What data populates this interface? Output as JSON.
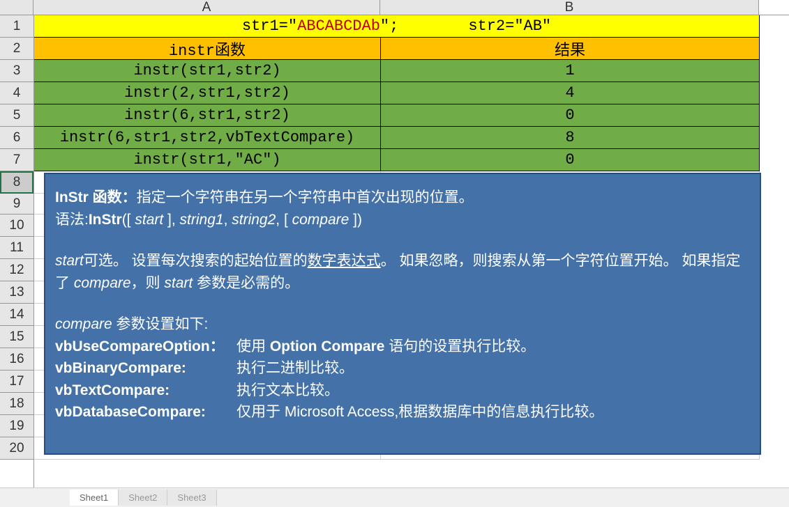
{
  "columns": {
    "a": "A",
    "b": "B"
  },
  "rows": [
    "1",
    "2",
    "3",
    "4",
    "5",
    "6",
    "7",
    "8",
    "9",
    "10",
    "11",
    "12",
    "13",
    "14",
    "15",
    "16",
    "17",
    "18",
    "19",
    "20"
  ],
  "header": {
    "str1_prefix": "str1=\"",
    "str1_red": "ABCABCDAb",
    "str1_suffix": "\";",
    "str2": "str2=\"AB\""
  },
  "row2": {
    "a": "instr函数",
    "b": "结果"
  },
  "data_rows": [
    {
      "a": "instr(str1,str2)",
      "b": "1"
    },
    {
      "a": "instr(2,str1,str2)",
      "b": "4"
    },
    {
      "a": "instr(6,str1,str2)",
      "b": "0"
    },
    {
      "a": "instr(6,str1,str2,vbTextCompare)",
      "b": "8"
    },
    {
      "a": "instr(str1,\"AC\")",
      "b": "0"
    }
  ],
  "doc": {
    "title_bold": "InStr 函数：",
    "title_rest": "指定一个字符串在另一个字符串中首次出现的位置。",
    "syntax_label": "语法:",
    "syntax_bold": "InStr",
    "syntax_rest1": "([ ",
    "syntax_i1": "start",
    "syntax_rest2": " ], ",
    "syntax_i2": "string1",
    "syntax_rest3": ", ",
    "syntax_i3": "string2",
    "syntax_rest4": ", [ ",
    "syntax_i4": "compare",
    "syntax_rest5": " ])",
    "start_i": "start",
    "start_text1": "可选。 设置每次搜索的起始位置的",
    "start_underline": "数字表达式",
    "start_text2": "。 如果忽略，则搜索从第一个字符位置开始。 如果指定了 ",
    "start_i2": "compare",
    "start_text3": "，则 ",
    "start_i3": "start",
    "start_text4": " 参数是必需的。",
    "compare_i": "compare",
    "compare_label": " 参数设置如下:",
    "options": [
      {
        "name": "vbUseCompareOption：",
        "desc_pre": "使用 ",
        "desc_bold": "Option Compare",
        "desc_post": " 语句的设置执行比较。"
      },
      {
        "name": "vbBinaryCompare:",
        "desc": "执行二进制比较。"
      },
      {
        "name": "vbTextCompare:",
        "desc": "执行文本比较。"
      },
      {
        "name": "vbDatabaseCompare:",
        "desc": "仅用于 Microsoft Access,根据数据库中的信息执行比较。"
      }
    ]
  },
  "tabs": [
    "Sheet1",
    "Sheet2",
    "Sheet3"
  ]
}
